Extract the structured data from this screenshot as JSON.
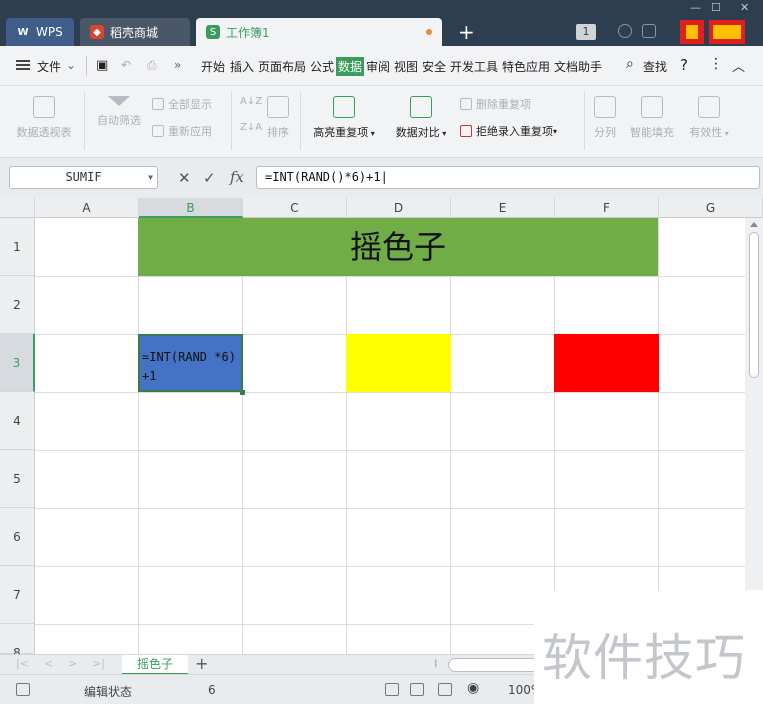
{
  "titlebar": {
    "tabs": [
      {
        "label": "WPS"
      },
      {
        "label": "稻壳商城"
      },
      {
        "label": "工作簿1"
      }
    ],
    "badge": "1"
  },
  "menubar": {
    "file": "文件",
    "items": [
      "开始",
      "插入",
      "页面布局",
      "公式",
      "数据",
      "审阅",
      "视图",
      "安全",
      "开发工具",
      "特色应用",
      "文档助手"
    ],
    "active": "数据",
    "search": "查找"
  },
  "ribbon": {
    "pivot": "数据透视表",
    "autofilter": "自动筛选",
    "show_all": "全部显示",
    "reapply": "重新应用",
    "sort": "排序",
    "highlight_dup": "高亮重复项",
    "compare": "数据对比",
    "delete_dup": "删除重复项",
    "reject_dup": "拒绝录入重复项",
    "split": "分列",
    "smart_fill": "智能填充",
    "validity": "有效性"
  },
  "formula_bar": {
    "name_box": "SUMIF",
    "formula": "=INT(RAND()*6)+1"
  },
  "grid": {
    "columns": [
      "A",
      "B",
      "C",
      "D",
      "E",
      "F",
      "G"
    ],
    "rows": [
      "1",
      "2",
      "3",
      "4",
      "5",
      "6",
      "7",
      "8"
    ],
    "title": "摇色子",
    "editing_cell": "=INT(RAND  *6)+1"
  },
  "sheets": {
    "active": "摇色子"
  },
  "status": {
    "mode": "编辑状态",
    "value": "6",
    "zoom": "100%"
  },
  "watermark": "软件技巧",
  "colors": {
    "accent": "#3a9d5d",
    "title_fill": "#70ad47",
    "edit_fill": "#4472c4",
    "yellow": "#ffff00",
    "red": "#ff0000"
  }
}
